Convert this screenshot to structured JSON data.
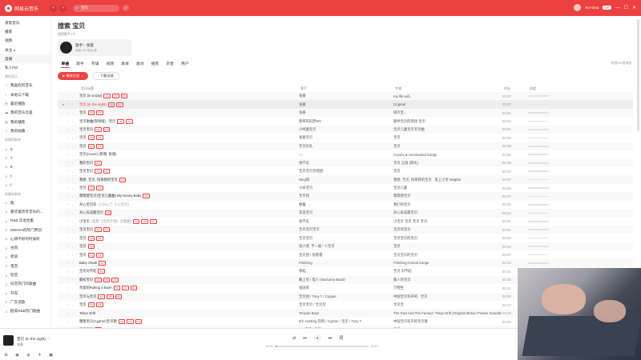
{
  "app": {
    "logo_text": "网易云音乐",
    "logo_glyph": "◉"
  },
  "topbar": {
    "back_glyph": "‹",
    "fwd_glyph": "›",
    "search_value": "宝贝",
    "search_icon": "🔍",
    "mic_glyph": "♪",
    "username": "Ro×Una",
    "vip_label": "VIP",
    "win_min": "—",
    "win_max": "☐",
    "win_close": "✕"
  },
  "sidebar": {
    "items": [
      {
        "label": "发现音乐",
        "icon": ""
      },
      {
        "label": "播客",
        "icon": ""
      },
      {
        "label": "视频",
        "icon": ""
      },
      {
        "label": "关注",
        "icon": "",
        "dot": true
      },
      {
        "label": "直播",
        "icon": "",
        "active": true
      },
      {
        "label": "私人FM",
        "icon": ""
      }
    ],
    "my_music_head": "我的音乐",
    "my_music": [
      {
        "label": "我喜欢的音乐",
        "icon": "♡"
      },
      {
        "label": "本地与下载",
        "icon": "↓"
      },
      {
        "label": "最近播放",
        "icon": "◷"
      },
      {
        "label": "我的音乐云盘",
        "icon": "☁"
      },
      {
        "label": "我的播客",
        "icon": "◎"
      },
      {
        "label": "我的收藏",
        "icon": "☆"
      }
    ],
    "created_head": "创建的歌单",
    "created": [
      {
        "label": "5",
        "icon": "♫"
      },
      {
        "label": "7",
        "icon": "♫"
      },
      {
        "label": "8",
        "icon": "♫"
      },
      {
        "label": "f",
        "icon": "♫"
      },
      {
        "label": "f",
        "icon": "♫"
      }
    ],
    "collected_head": "收藏的歌单",
    "collected": [
      {
        "label": "嗯",
        "icon": "♫"
      },
      {
        "label": "奢华富贵有音乐的...",
        "icon": "♫"
      },
      {
        "label": "R&B 华语合集",
        "icon": "♫"
      },
      {
        "label": "Mizmmi的热门原创",
        "icon": "♫"
      },
      {
        "label": "心情不好的时候听",
        "icon": "♫"
      },
      {
        "label": "古风",
        "icon": "♫"
      },
      {
        "label": "摇滚",
        "icon": "♫"
      },
      {
        "label": "电音",
        "icon": "♫"
      },
      {
        "label": "轻音",
        "icon": "♫"
      },
      {
        "label": "抖音热门的歌曲",
        "icon": "♫"
      },
      {
        "label": "开车",
        "icon": "♫"
      },
      {
        "label": "广东话歌",
        "icon": "♫"
      },
      {
        "label": "欧美R&B热门歌曲",
        "icon": "♫"
      }
    ]
  },
  "main": {
    "title": "搜索 宝贝",
    "found_label": "找到歌手1个",
    "artist_card": {
      "name": "歌手：张蔷",
      "sub": "单曲:100  粉丝:数"
    },
    "tabs": [
      "单曲",
      "歌手",
      "专辑",
      "视频",
      "歌单",
      "歌词",
      "播客",
      "声音",
      "用户"
    ],
    "count_note": "找到300首单曲",
    "play_all": "▶ 播放全部",
    "play_all_plus": "+",
    "download_all": "↓ 下载全部",
    "columns": [
      "音乐标题",
      "歌手",
      "专辑",
      "时长",
      "热度"
    ],
    "op_like": "♡",
    "op_dl": "↓",
    "op_more": "…"
  },
  "songs": [
    {
      "title": "宝贝 (in a Day)",
      "sub": "",
      "tags": [
        "SQ",
        "VIP",
        "MV"
      ],
      "artist": "张蔷",
      "album": "my life will...",
      "dur": "03:27"
    },
    {
      "title": "宝贝 (in the night)",
      "sub": "",
      "tags": [
        "SQ",
        "MV"
      ],
      "artist": "张蔷",
      "album": "Original",
      "dur": "03:47",
      "playing": true
    },
    {
      "title": "宝贝",
      "sub": "",
      "tags": [
        "SQ",
        "VIP"
      ],
      "artist": "张悬",
      "album": "城市里...",
      "dur": "03:31"
    },
    {
      "title": "宝贝歌曲(现场版) · 宝贝",
      "sub": "",
      "tags": [
        "VIP",
        "MV"
      ],
      "artist": "蔡琴的旧梦MV",
      "album": "那件宝贝的现场 宝贝",
      "dur": "03:04"
    },
    {
      "title": "宝贝宝贝",
      "sub": "",
      "tags": [
        "SQ",
        "VIP"
      ],
      "artist": "小柯童宝贝",
      "album": "宝贝儿童宝贝宝贝曲",
      "dur": "03:31"
    },
    {
      "title": "宝贝",
      "sub": "",
      "tags": [
        "SQ",
        "VIP"
      ],
      "artist": "张蔷宝贝",
      "album": "宝贝",
      "dur": "02:59"
    },
    {
      "title": "宝贝",
      "sub": "",
      "tags": [
        "SQ",
        "VIP"
      ],
      "artist": "宝贝乐队",
      "album": "宝贝",
      "dur": "02:38"
    },
    {
      "title": "宝贝(Cover) (原唱: 张悬)",
      "sub": "",
      "tags": [],
      "artist": "—",
      "album": "Covers & Unreleased Songs",
      "dur": "03:39"
    },
    {
      "title": "我的宝贝",
      "sub": "",
      "tags": [
        "SQ"
      ],
      "artist": "张学友",
      "album": "宝贝 王国 (明天)",
      "dur": "02:39"
    },
    {
      "title": "宝贝宝贝",
      "sub": "",
      "tags": [
        "SQ",
        "VIP"
      ],
      "artist": "宝贝宝贝合唱团",
      "album": "宝贝",
      "dur": "03:33"
    },
    {
      "title": "我想, 宝贝, 快来我的宝贝",
      "sub": "",
      "tags": [
        "SQ"
      ],
      "artist": "Ning阳",
      "album": "我想, 宝贝, 快来我的宝贝 · 爱上小宝 Maglab",
      "dur": "02:57"
    },
    {
      "title": "宝贝",
      "sub": "",
      "tags": [
        "SQ",
        "VIP"
      ],
      "artist": "小米宝贝",
      "album": "宝贝儿童",
      "dur": "03:09"
    },
    {
      "title": "嗯嗯嗯宝贝(宝贝儿童曲) My Honey Baby",
      "sub": "",
      "tags": [
        "SQ"
      ],
      "artist": "宝贝团",
      "album": "嗯嗯嗯宝贝",
      "dur": "03:27"
    },
    {
      "title": "开心宝贝乐",
      "sub": "(小开心了 小心宝贝)",
      "tags": [],
      "artist": "静蕾",
      "album": "我们的宝贝",
      "dur": "03:35"
    },
    {
      "title": "开心有成都宝贝",
      "sub": "",
      "tags": [
        "SQ"
      ],
      "artist": "花莲宝贝",
      "album": "开心有成都宝贝",
      "dur": "03:24"
    },
    {
      "title": "小宝贝",
      "sub": "(电影《宝贝计划》主题曲)",
      "tags": [
        "SQ",
        "VIP",
        "MV"
      ],
      "artist": "张学友",
      "album": "小宝贝 宝贝 宝贝 宝贝",
      "dur": "03:21"
    },
    {
      "title": "宝贝宝贝",
      "sub": "",
      "tags": [
        "SQ",
        "VIP"
      ],
      "artist": "宝贝宝贝宝贝",
      "album": "宝贝的宝贝",
      "dur": "03:31"
    },
    {
      "title": "宝贝",
      "sub": "",
      "tags": [
        "SQ",
        "VIP"
      ],
      "artist": "宝贝宝贝",
      "album": "宝贝宝贝的宝贝",
      "dur": "03:53"
    },
    {
      "title": "宝贝",
      "sub": "",
      "tags": [
        "SQ"
      ],
      "artist": "张小斐, 不一般 / 人宝贝",
      "album": "宝贝",
      "dur": "03:33"
    },
    {
      "title": "宝贝",
      "sub": "",
      "tags": [
        "SQ",
        "VIP"
      ],
      "artist": "宝贝团 / 张雷雷",
      "album": "宝贝宝贝的宝贝",
      "dur": "03:07"
    },
    {
      "title": "Baby Shark",
      "sub": "",
      "tags": [
        "SQ"
      ],
      "artist": "Pinkfong",
      "album": "Pinkfong Animal Songs",
      "dur": "01:23"
    },
    {
      "title": "宝贝对不起",
      "sub": "",
      "tags": [
        "SQ"
      ],
      "artist": "草蜢",
      "album": "宝贝 对不起",
      "dur": "04:31"
    },
    {
      "title": "最初宝贝",
      "sub": "",
      "tags": [
        "SQ",
        "VIP",
        "MV"
      ],
      "artist": "鞠上花 / 电人 (Nocturne Band)",
      "album": "狼人的宝贝",
      "dur": "03:35"
    },
    {
      "title": "亲爱的Rolling a Bush",
      "sub": "",
      "tags": [
        "SQ",
        "VIP",
        "MV"
      ],
      "artist": "张国荣",
      "album": "万物生",
      "dur": "03:11"
    },
    {
      "title": "宝贝与宝贝",
      "sub": "",
      "tags": [
        "SQ",
        "VIP",
        "MV"
      ],
      "artist": "宝贝团 / Tony T / Copper",
      "album": "中国宝贝有声的 · 宝贝",
      "dur": "03:00"
    },
    {
      "title": "宝贝",
      "sub": "",
      "tags": [
        "SQ",
        "VIP"
      ],
      "artist": "宝贝宝贝 / 宝贝宝",
      "album": "宝贝宝",
      "dur": "02:17"
    },
    {
      "title": "Tokyo Drift",
      "sub": "",
      "tags": [],
      "artist": "Teriyaki Boyz",
      "album": "The Fast And The Furious: Tokyo Drift (Original Motion Picture Soundtr...",
      "dur": "04:15"
    },
    {
      "title": "嗯嗯宝贝(Cypher)宝贝歌",
      "sub": "",
      "tags": [
        "SQ",
        "VIP",
        "MV"
      ],
      "artist": "9/C HotDog 热狗 / Cypher / 宝贝 / Tony T",
      "album": "中国宝贝有声的宝贝歌",
      "dur": "04:00"
    },
    {
      "title": "宝贝宝贝",
      "sub": "",
      "tags": [
        "SQ"
      ],
      "artist": "AR 宝贝 / 宝贝",
      "album": "宝贝 AR",
      "dur": "03:24"
    }
  ],
  "player": {
    "title": "宝贝 (in the night)",
    "artist": "张蔷",
    "like": "♡",
    "prev": "⏮",
    "mode": "⇄",
    "pause": "⏸",
    "next": "⏭",
    "lyric": "词",
    "time_cur": "00:01",
    "time_total": "03:47",
    "progress": 0.01
  },
  "taskbar": [
    "⊞",
    "◉",
    "◍",
    "✈",
    "▣"
  ]
}
